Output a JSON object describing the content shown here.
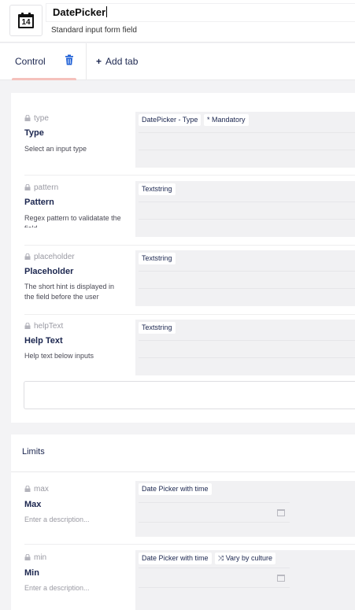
{
  "header": {
    "icon": "calendar-icon",
    "icon_day": "14",
    "name": "DatePicker",
    "description": "Standard input form field"
  },
  "tabs": {
    "active": "Control",
    "delete_icon": "trash-icon",
    "add_label": "Add tab",
    "add_icon": "plus-icon",
    "accent_color": "#f5c1bc"
  },
  "control": {
    "properties": [
      {
        "alias": "type",
        "label": "Type",
        "description": "Select an input type",
        "chips": [
          "DatePicker - Type",
          "* Mandatory"
        ]
      },
      {
        "alias": "pattern",
        "label": "Pattern",
        "description": "Regex pattern to validatate the field",
        "chips": [
          "Textstring"
        ]
      },
      {
        "alias": "placeholder",
        "label": "Placeholder",
        "description": "The short hint is displayed in the field before the user",
        "chips": [
          "Textstring"
        ]
      },
      {
        "alias": "helpText",
        "label": "Help Text",
        "description": "Help text below inputs",
        "chips": [
          "Textstring"
        ]
      }
    ]
  },
  "limits": {
    "title": "Limits",
    "properties": [
      {
        "alias": "max",
        "label": "Max",
        "description": "Enter a description...",
        "chip": "Date Picker with time",
        "vary": ""
      },
      {
        "alias": "min",
        "label": "Min",
        "description": "Enter a description...",
        "chip": "Date Picker with time",
        "vary": "Vary by culture"
      }
    ]
  }
}
